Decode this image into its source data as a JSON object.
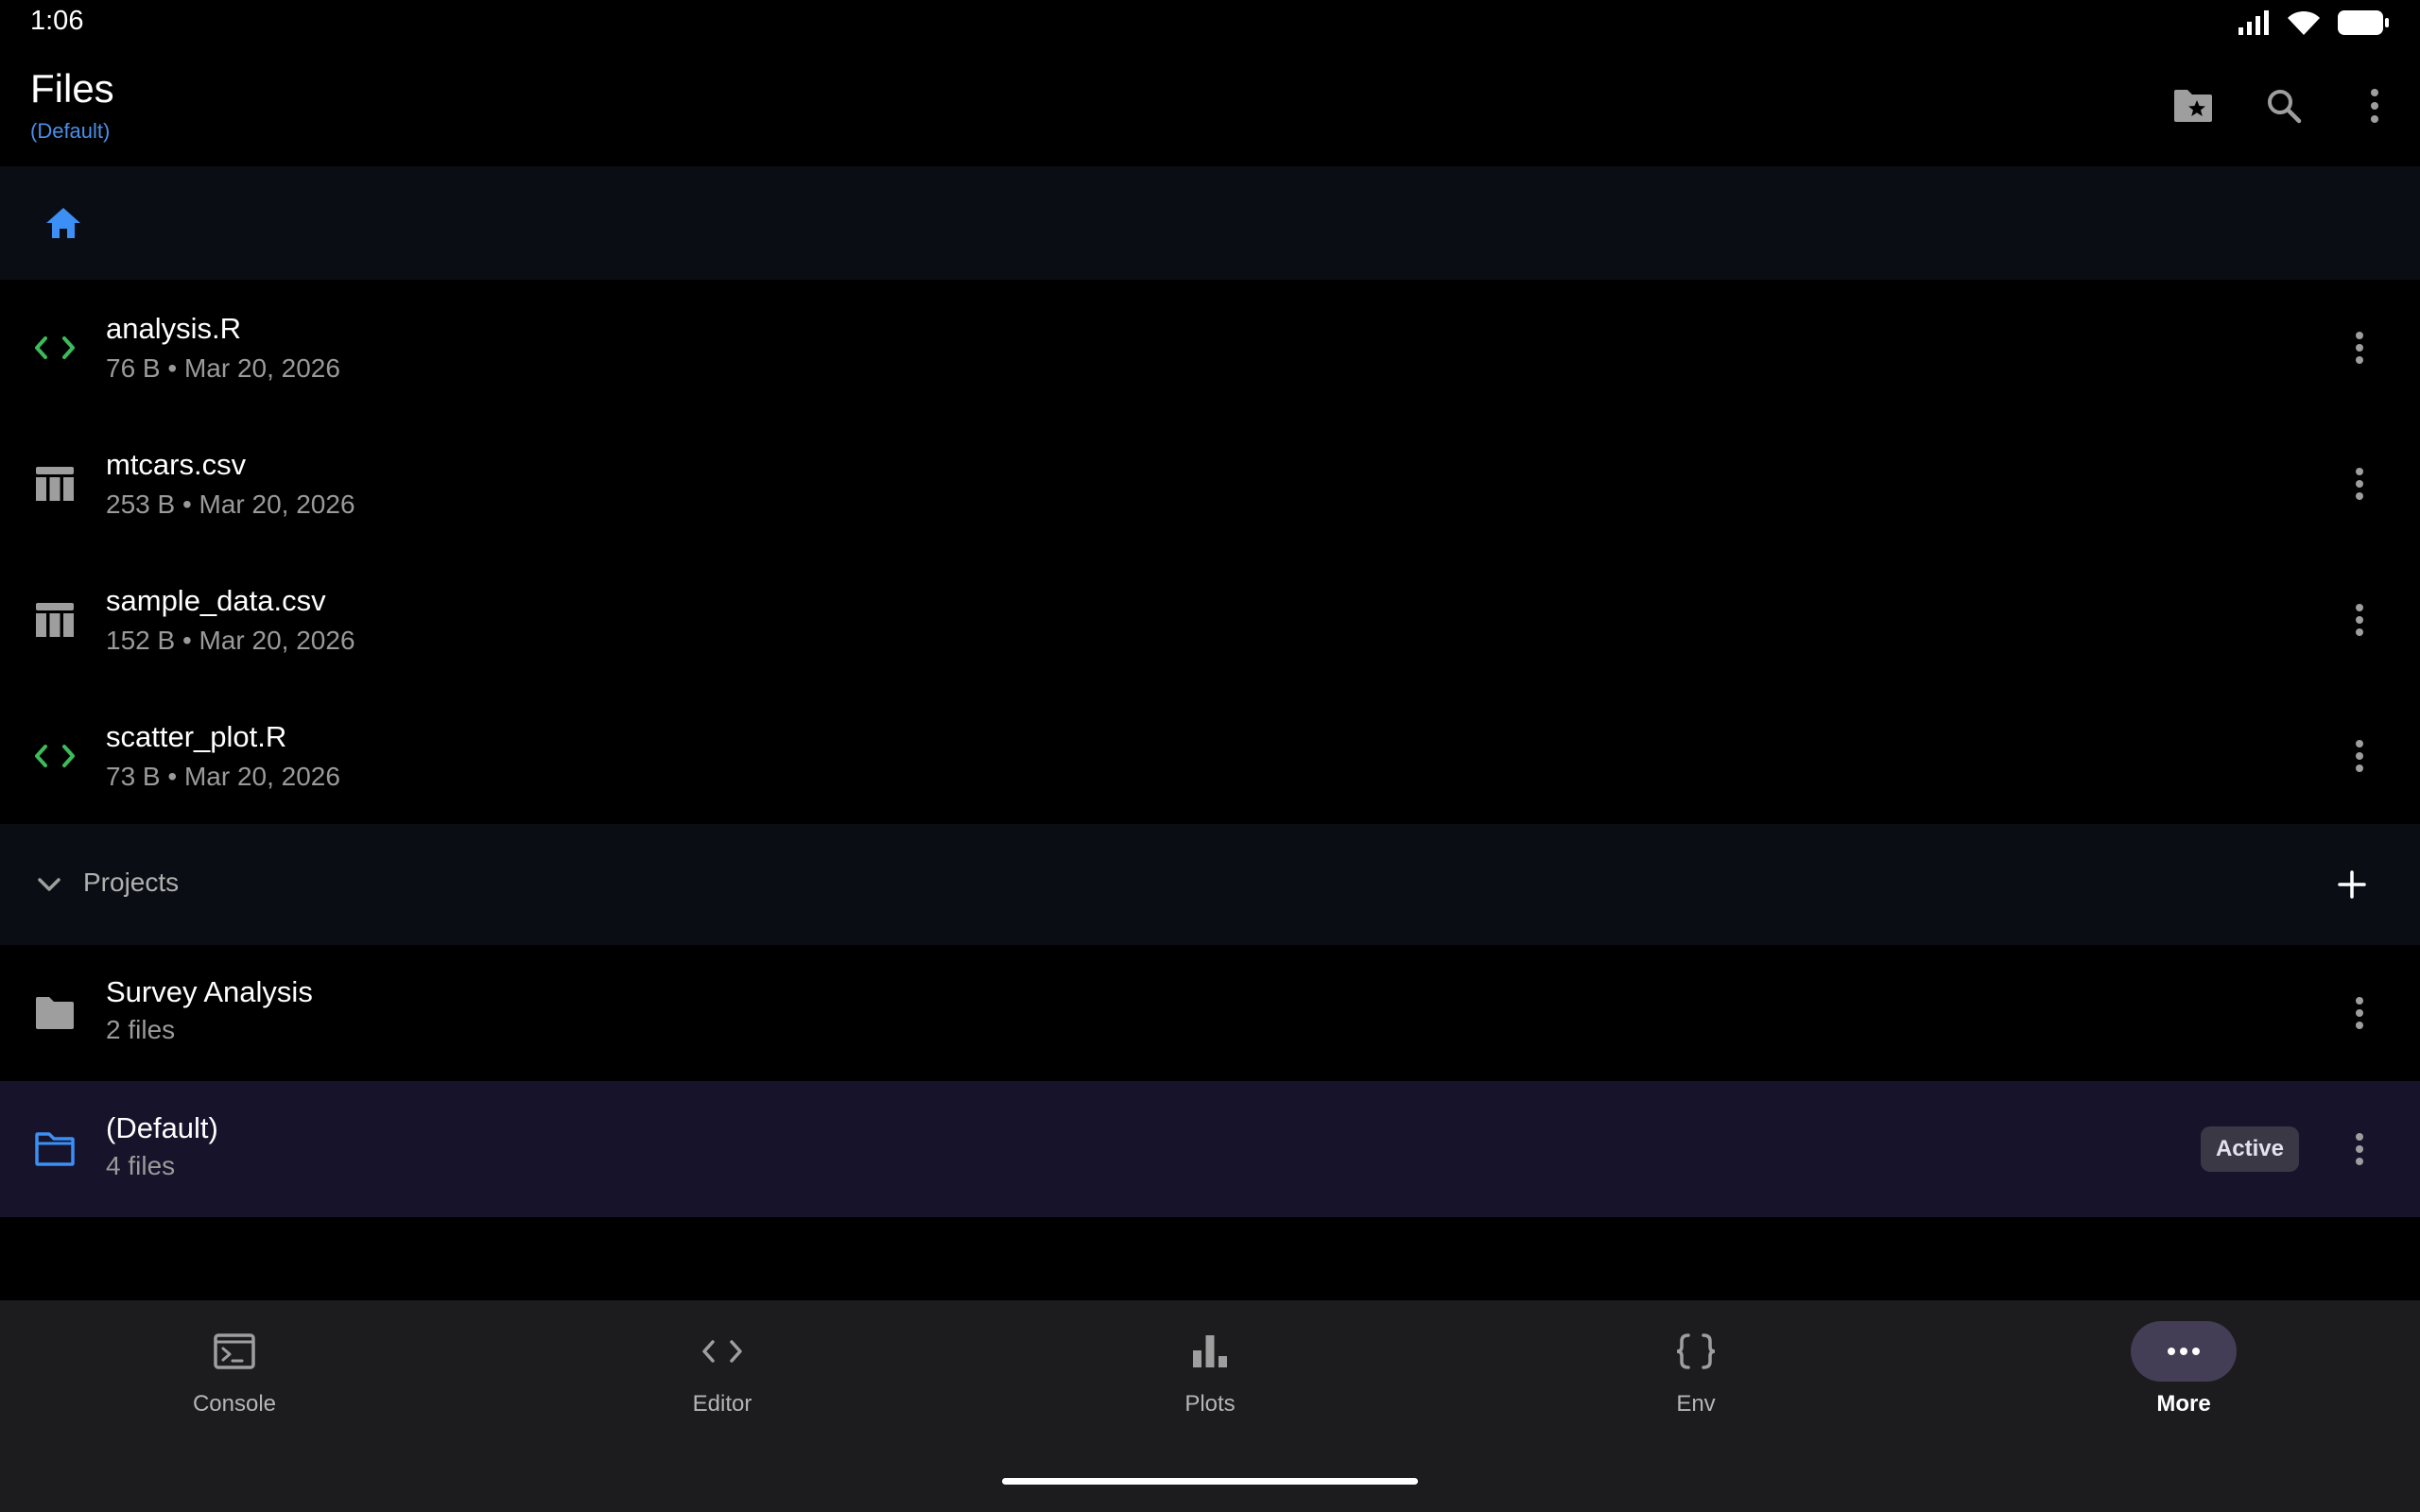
{
  "status_bar": {
    "time": "1:06"
  },
  "app_bar": {
    "title": "Files",
    "subtitle": "(Default)"
  },
  "files": [
    {
      "name": "analysis.R",
      "meta": "76 B • Mar 20, 2026",
      "icon": "code-icon"
    },
    {
      "name": "mtcars.csv",
      "meta": "253 B • Mar 20, 2026",
      "icon": "table-icon"
    },
    {
      "name": "sample_data.csv",
      "meta": "152 B • Mar 20, 2026",
      "icon": "table-icon"
    },
    {
      "name": "scatter_plot.R",
      "meta": "73 B • Mar 20, 2026",
      "icon": "code-icon"
    }
  ],
  "projects": {
    "label": "Projects",
    "items": [
      {
        "name": "Survey Analysis",
        "meta": "2 files",
        "icon": "folder-icon"
      },
      {
        "name": "(Default)",
        "meta": "4 files",
        "icon": "folder-open-icon",
        "badge": "Active"
      }
    ]
  },
  "bottom_nav": [
    {
      "label": "Console",
      "icon": "terminal-icon"
    },
    {
      "label": "Editor",
      "icon": "code-icon"
    },
    {
      "label": "Plots",
      "icon": "bar-chart-icon"
    },
    {
      "label": "Env",
      "icon": "braces-icon"
    },
    {
      "label": "More",
      "icon": "more-horizontal-icon",
      "selected": true
    }
  ],
  "colors": {
    "background": "#000000",
    "accent_blue": "#4a8fe8",
    "code_green": "#3dbb5a",
    "icon_gray": "#9e9e9e",
    "active_row": "#16132b",
    "section_bg": "#0a0e14",
    "nav_bg": "#1c1c1e"
  }
}
